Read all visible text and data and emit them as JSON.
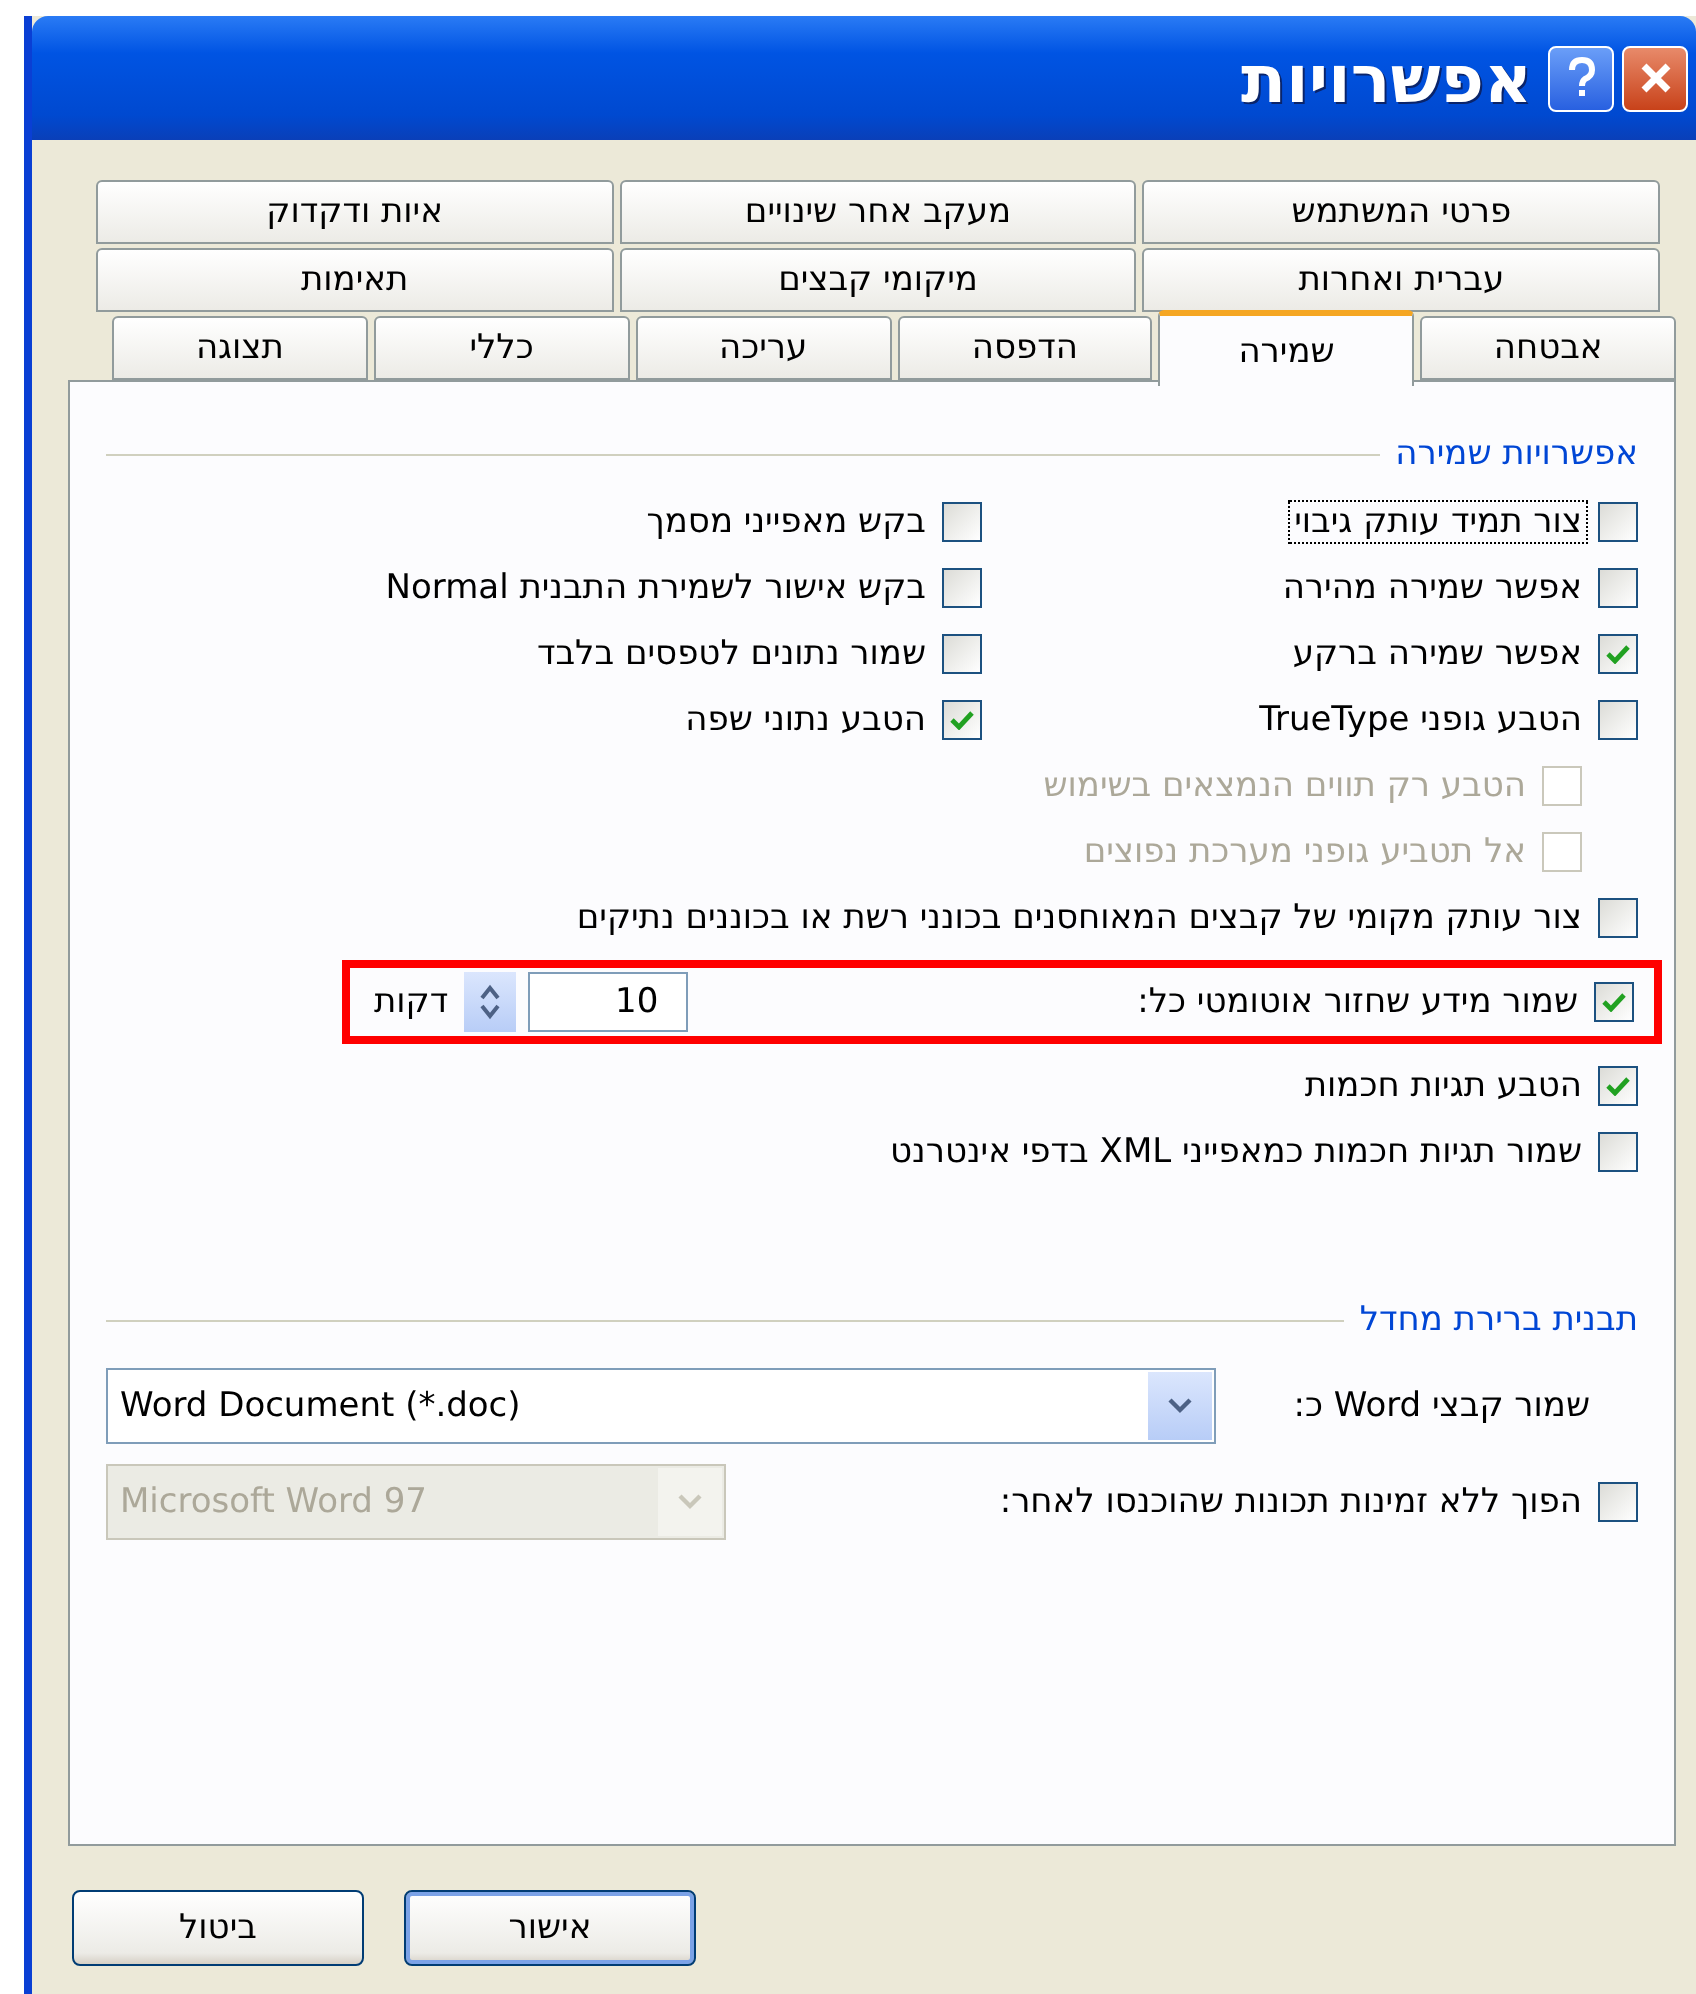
{
  "window": {
    "title": "אפשרויות"
  },
  "tab_rows": [
    [
      {
        "label": "פרטי המשתמש",
        "selected": false
      },
      {
        "label": "מעקב אחר שינויים",
        "selected": false
      },
      {
        "label": "איות ודקדוק",
        "selected": false
      }
    ],
    [
      {
        "label": "עברית ואחרות",
        "selected": false
      },
      {
        "label": "מיקומי קבצים",
        "selected": false
      },
      {
        "label": "תאימות",
        "selected": false
      }
    ],
    [
      {
        "label": "אבטחה",
        "selected": false
      },
      {
        "label": "שמירה",
        "selected": true
      },
      {
        "label": "הדפסה",
        "selected": false
      },
      {
        "label": "עריכה",
        "selected": false
      },
      {
        "label": "כללי",
        "selected": false
      },
      {
        "label": "תצוגה",
        "selected": false
      }
    ]
  ],
  "save_options": {
    "title": "אפשרויות שמירה",
    "grid": [
      {
        "label": "צור תמיד עותק גיבוי",
        "checked": false,
        "focused": true
      },
      {
        "label": "בקש מאפייני מסמך",
        "checked": false,
        "focused": false
      },
      {
        "label": "אפשר שמירה מהירה",
        "checked": false,
        "focused": false
      },
      {
        "label": "בקש אישור לשמירת התבנית Normal",
        "checked": false,
        "focused": false
      },
      {
        "label": "אפשר שמירה ברקע",
        "checked": true,
        "focused": false
      },
      {
        "label": "שמור נתונים לטפסים בלבד",
        "checked": false,
        "focused": false
      },
      {
        "label": "הטבע גופני TrueType",
        "checked": false,
        "focused": false
      },
      {
        "label": "הטבע נתוני שפה",
        "checked": true,
        "focused": false
      }
    ],
    "sub_options": [
      {
        "label": "הטבע רק תווים הנמצאים בשימוש",
        "checked": false,
        "disabled": true
      },
      {
        "label": "אל תטביע גופני מערכת נפוצים",
        "checked": false,
        "disabled": true
      }
    ],
    "options": [
      {
        "kind": "checkbox",
        "label": "צור עותק מקומי של קבצים המאוחסנים בכונני רשת או בכוננים נתיקים",
        "checked": false
      },
      {
        "kind": "spinner",
        "label": "שמור מידע שחזור אוטומטי כל:",
        "checked": true,
        "value": "10",
        "unit": "דקות",
        "highlighted": true
      },
      {
        "kind": "checkbox",
        "label": "הטבע תגיות חכמות",
        "checked": true
      },
      {
        "kind": "checkbox",
        "label": "שמור תגיות חכמות כמאפייני XML בדפי אינטרנט",
        "checked": false
      }
    ]
  },
  "default_format": {
    "title": "תבנית ברירת מחדל",
    "save_as": {
      "label": "שמור קבצי Word כ:",
      "value": "Word Document (*.doc)",
      "disabled": false
    },
    "disable_features": {
      "label": "הפוך ללא זמינות תכונות שהוכנסו לאחר:",
      "checked": false,
      "value": "Microsoft Word 97",
      "disabled": true
    }
  },
  "buttons": [
    {
      "label": "אישור",
      "default": true
    },
    {
      "label": "ביטול",
      "default": false
    }
  ]
}
